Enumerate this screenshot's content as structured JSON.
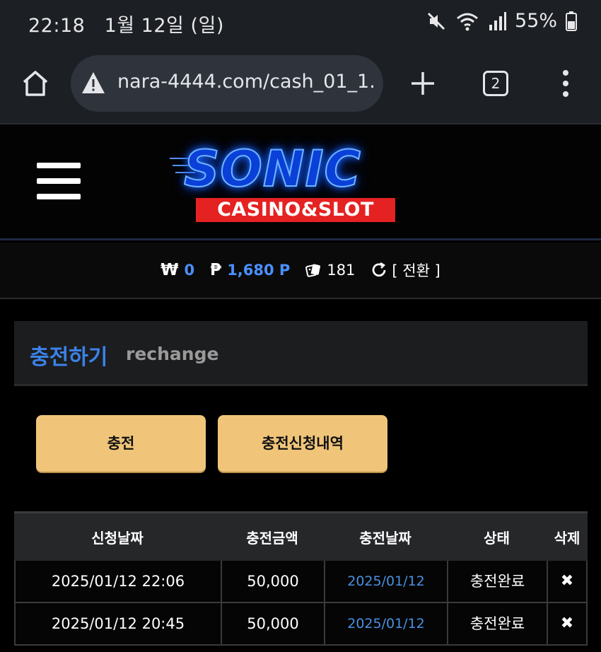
{
  "status_bar": {
    "time": "22:18",
    "date": "1월 12일 (일)",
    "battery": "55%",
    "icons": [
      "mute-icon",
      "wifi-icon",
      "signal-icon",
      "battery-icon"
    ]
  },
  "browser": {
    "url": "nara-4444.com/cash_01_1.",
    "tab_count": "2",
    "icons": [
      "home-icon",
      "warning-icon",
      "plus-icon",
      "tabs-icon",
      "more-icon"
    ]
  },
  "header": {
    "logo_main": "SONIC",
    "logo_sub": "CASINO&SLOT",
    "menu_icon": "hamburger-icon"
  },
  "balance": {
    "won_symbol": "₩",
    "won_value": "0",
    "point_symbol": "₱",
    "point_value": "1,680 P",
    "dice_value": "181",
    "switch_label": "[ 전환 ]"
  },
  "section": {
    "title_ko": "충전하기",
    "title_en": "rechange"
  },
  "buttons": {
    "charge": "충전",
    "history": "충전신청내역"
  },
  "table": {
    "headers": [
      "신청날짜",
      "충전금액",
      "충전날짜",
      "상태",
      "삭제"
    ],
    "rows": [
      {
        "request_date": "2025/01/12 22:06",
        "amount": "50,000",
        "charge_date": "2025/01/12",
        "status": "충전완료",
        "delete": "✖"
      },
      {
        "request_date": "2025/01/12 20:45",
        "amount": "50,000",
        "charge_date": "2025/01/12",
        "status": "충전완료",
        "delete": "✖"
      }
    ]
  },
  "colors": {
    "accent_blue": "#3b82e8",
    "button_gold": "#f0c57a",
    "logo_red": "#e52222"
  }
}
